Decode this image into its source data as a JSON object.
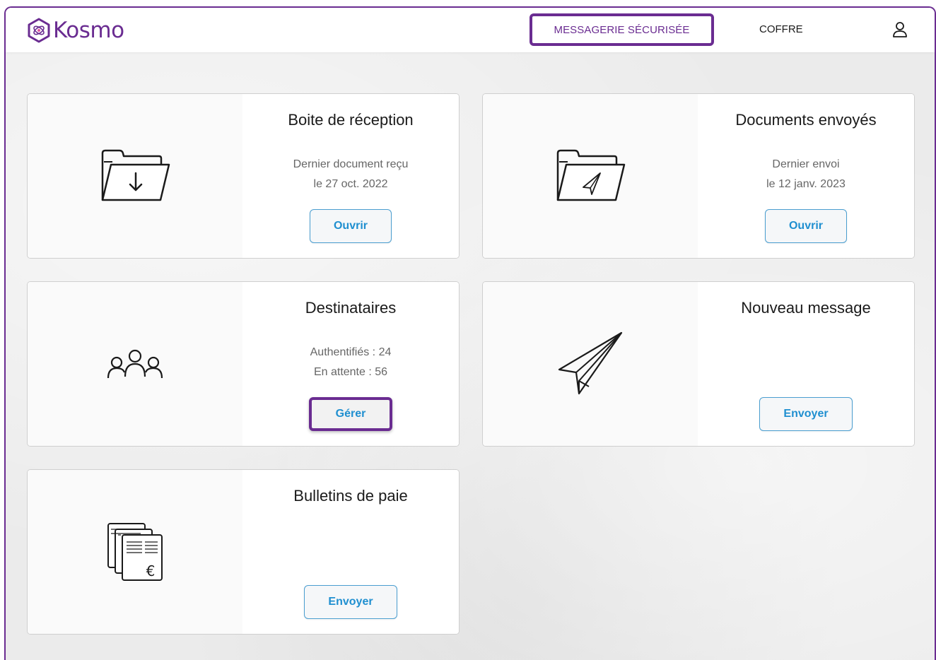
{
  "header": {
    "logo_text": "Kosmo",
    "nav_messagerie": "MESSAGERIE SÉCURISÉE",
    "nav_coffre": "COFFRE",
    "user_icon": "user-icon"
  },
  "cards": {
    "inbox": {
      "title": "Boite de réception",
      "line1": "Dernier document reçu",
      "line2": "le 27 oct. 2022",
      "button": "Ouvrir",
      "icon": "folder-download-icon"
    },
    "sent": {
      "title": "Documents envoyés",
      "line1": "Dernier envoi",
      "line2": "le 12 janv. 2023",
      "button": "Ouvrir",
      "icon": "folder-sent-icon"
    },
    "recipients": {
      "title": "Destinataires",
      "line1": "Authentifiés : 24",
      "line2": "En attente : 56",
      "button": "Gérer",
      "icon": "group-users-icon"
    },
    "new_message": {
      "title": "Nouveau message",
      "button": "Envoyer",
      "icon": "paper-plane-icon"
    },
    "payslips": {
      "title": "Bulletins de paie",
      "button": "Envoyer",
      "icon": "payslip-documents-icon"
    }
  },
  "colors": {
    "brand": "#6a2c91",
    "button_text": "#1f8fd0",
    "button_border": "#4a9ed0"
  }
}
